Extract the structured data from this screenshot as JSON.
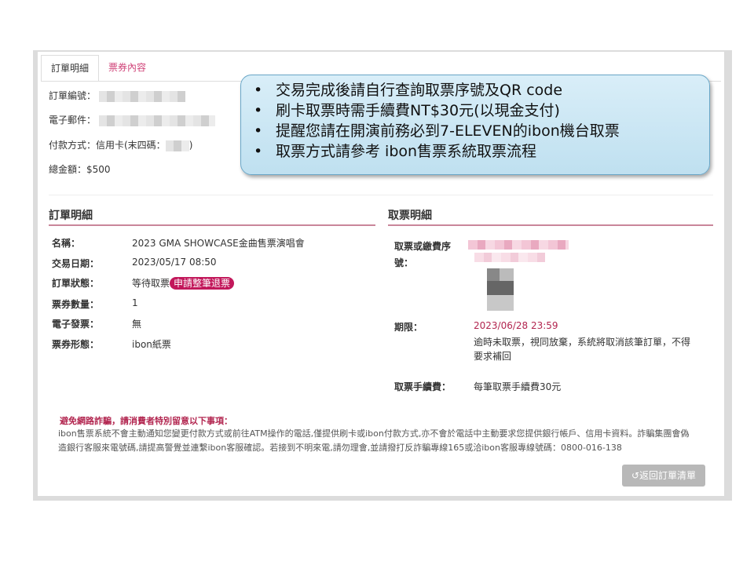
{
  "tabs": {
    "order_detail": "訂單明細",
    "ticket_content": "票券內容"
  },
  "order_info": {
    "order_no_label": "訂單編號：",
    "email_label": "電子郵件：",
    "payment_prefix": "付款方式：信用卡(末四碼：",
    "payment_suffix": ")",
    "total": "總金額：$500"
  },
  "callout": {
    "items": [
      "交易完成後請自行查詢取票序號及QR code",
      "刷卡取票時需手續費NT$30元(以現金支付)",
      "提醒您請在開演前務必到7-ELEVEN的ibon機台取票",
      "取票方式請參考 ibon售票系統取票流程"
    ]
  },
  "order_detail": {
    "title": "訂單明細",
    "name_label": "名稱：",
    "name_value": "2023 GMA SHOWCASE金曲售票演唱會",
    "date_label": "交易日期：",
    "date_value": "2023/05/17 08:50",
    "status_label": "訂單狀態：",
    "status_value": "等待取票",
    "refund_button": "申請整筆退票",
    "qty_label": "票券數量：",
    "qty_value": "1",
    "einvoice_label": "電子發票：",
    "einvoice_value": "無",
    "type_label": "票券形態：",
    "type_value": "ibon紙票"
  },
  "pickup_detail": {
    "title": "取票明細",
    "code_label_line1": "取票或繳費序",
    "code_label_line2": "號：",
    "deadline_label": "期限：",
    "deadline_value": "2023/06/28 23:59",
    "deadline_note_line1": "逾時未取票，視同放棄，系統將取消該筆訂單，不得",
    "deadline_note_line2": "要求補回",
    "fee_label": "取票手續費：",
    "fee_value": "每筆取票手續費30元"
  },
  "warning": {
    "title": "避免網路詐騙，請消費者特別留意以下事項：",
    "line1": "ibon售票系統不會主動通知您變更付款方式或前往ATM操作的電話,僅提供刷卡或ibon付款方式,亦不會於電話中主動要求您提供銀行帳戶、信用卡資料。詐騙集團會偽",
    "line2": "造銀行客服來電號碼,請提高警覺並連繫ibon客服確認。若接到不明來電,請勿理會,並請撥打反詐騙專線165或洽ibon客服專線號碼：0800-016-138"
  },
  "back_button": "↺返回訂單清單",
  "colors": {
    "accent": "#c2185b",
    "tab_pink": "#d0457a",
    "warning_title": "#b2254f",
    "callout_bg": "#cfe8f5"
  }
}
